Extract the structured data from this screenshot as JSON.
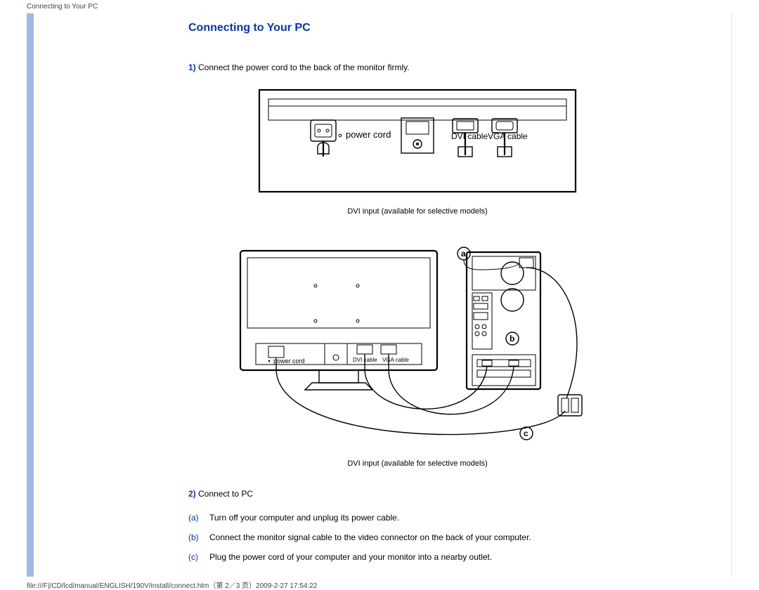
{
  "header_path": "Connecting to Your PC",
  "title": "Connecting to Your PC",
  "step1": {
    "num": "1)",
    "text": " Connect the power cord to the back of the monitor firmly."
  },
  "caption1": "DVI input (available for selective models)",
  "caption2": "DVI input (available for selective models)",
  "step2": {
    "num": "2)",
    "text": " Connect to PC"
  },
  "sub": {
    "a": {
      "label": "(a)",
      "text": "Turn off your computer and unplug its power cable."
    },
    "b": {
      "label": "(b)",
      "text": "Connect the monitor signal cable to the video connector on the back of your computer."
    },
    "c": {
      "label": "(c)",
      "text": "Plug the power cord of your computer and your monitor into a nearby outlet."
    }
  },
  "fig1": {
    "power_cord": "power cord",
    "dvi": "DVI cable",
    "vga": "VGA cable"
  },
  "fig2": {
    "power_cord": "power cord",
    "dvi": "DVI cable",
    "vga": "VGA cable",
    "a": "a",
    "b": "b",
    "c": "c"
  },
  "footer_path": "file:///F|/CD/lcd/manual/ENGLISH/190V/install/connect.htm（第 2／3 页）2009-2-27 17:54:22"
}
